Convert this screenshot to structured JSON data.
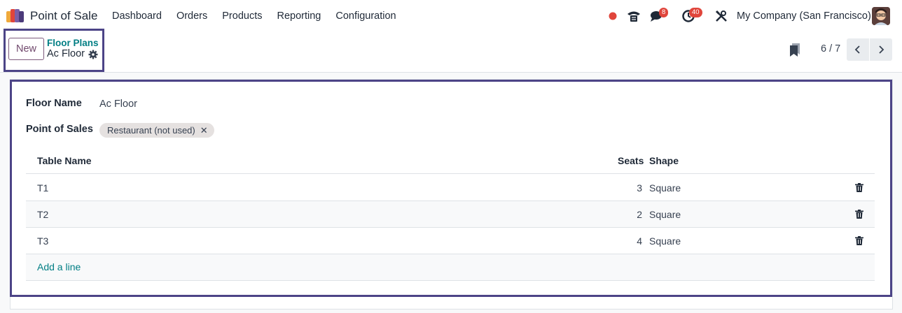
{
  "navbar": {
    "app_name": "Point of Sale",
    "menu": [
      "Dashboard",
      "Orders",
      "Products",
      "Reporting",
      "Configuration"
    ],
    "messages_count": "8",
    "activities_count": "40",
    "company": "My Company (San Francisco)",
    "status_color": "#e0453b"
  },
  "control_panel": {
    "new_label": "New",
    "breadcrumb_parent": "Floor Plans",
    "breadcrumb_current": "Ac Floor",
    "pager_value": "6 / 7"
  },
  "form": {
    "floor_name_label": "Floor Name",
    "floor_name_value": "Ac Floor",
    "pos_label": "Point of Sales",
    "pos_tag": "Restaurant (not used)",
    "pos_tag_remove": "✕",
    "table": {
      "headers": {
        "name": "Table Name",
        "seats": "Seats",
        "shape": "Shape"
      },
      "rows": [
        {
          "name": "T1",
          "seats": "3",
          "shape": "Square"
        },
        {
          "name": "T2",
          "seats": "2",
          "shape": "Square"
        },
        {
          "name": "T3",
          "seats": "4",
          "shape": "Square"
        }
      ],
      "add_line": "Add a line"
    }
  },
  "colors": {
    "brand": "#71496d",
    "link": "#017e84",
    "highlight": "#4c4487"
  }
}
